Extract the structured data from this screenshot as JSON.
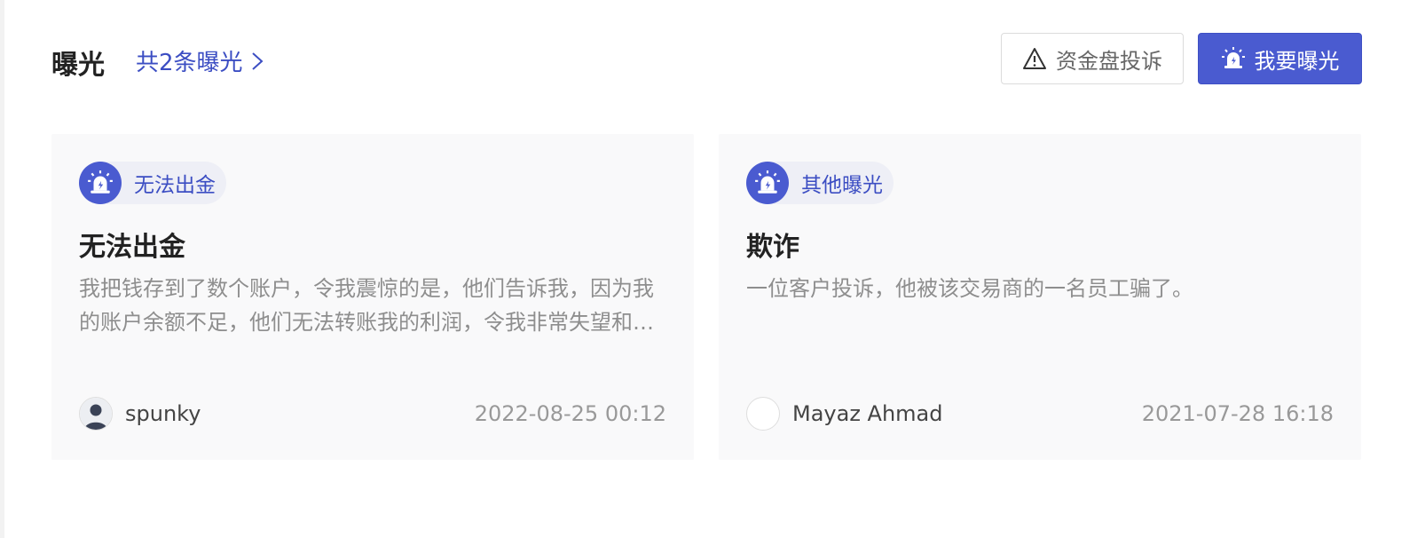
{
  "header": {
    "title": "曝光",
    "count_link": "共2条曝光",
    "complaint_button": "资金盘投诉",
    "expose_button": "我要曝光"
  },
  "cards": [
    {
      "tag": "无法出金",
      "title": "无法出金",
      "description": "我把钱存到了数个账户，令我震惊的是，他们告诉我，因为我的账户余额不足，他们无法转账我的利润，令我非常失望和愤怒，希望大家引以为戒。",
      "author": "spunky",
      "date": "2022-08-25 00:12"
    },
    {
      "tag": "其他曝光",
      "title": "欺诈",
      "description": "一位客户投诉，他被该交易商的一名员工骗了。",
      "author": "Mayaz Ahmad",
      "date": "2021-07-28 16:18"
    }
  ],
  "icons": {
    "count_link": "chevron-right-icon",
    "complaint": "warning-icon",
    "expose": "alarm-icon",
    "tag": "alarm-icon",
    "avatar": "avatar-icon"
  },
  "colors": {
    "accent": "#4a5bd0",
    "link": "#3c4ec3",
    "card_bg": "#f9f9fa",
    "tag_bg": "#eeeff6"
  }
}
